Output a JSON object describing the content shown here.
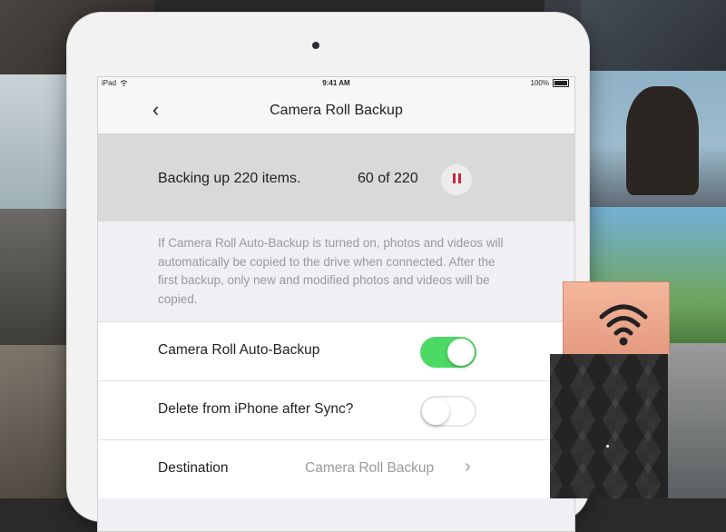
{
  "status_bar": {
    "carrier": "iPad",
    "time": "9:41 AM",
    "battery": "100%"
  },
  "nav": {
    "back_icon": "chevron-left-icon",
    "title": "Camera Roll Backup"
  },
  "backup_progress": {
    "message": "Backing up 220 items.",
    "count": "60 of 220",
    "done": 60,
    "total": 220,
    "pause_icon": "pause-icon",
    "pause_color": "#d0263a"
  },
  "info_text": "If Camera Roll Auto-Backup is turned on, photos and videos will automatically be copied to the drive when connected. After the first backup, only new and modified photos and videos will be copied.",
  "settings": {
    "auto_backup": {
      "label": "Camera Roll Auto-Backup",
      "enabled": true
    },
    "delete_after_sync": {
      "label": "Delete from iPhone after Sync?",
      "enabled": false
    },
    "destination": {
      "label": "Destination",
      "value": "Camera Roll Backup",
      "icon": "chevron-right-icon"
    }
  },
  "colors": {
    "toggle_on": "#4cd964",
    "accent_red": "#d0263a"
  }
}
